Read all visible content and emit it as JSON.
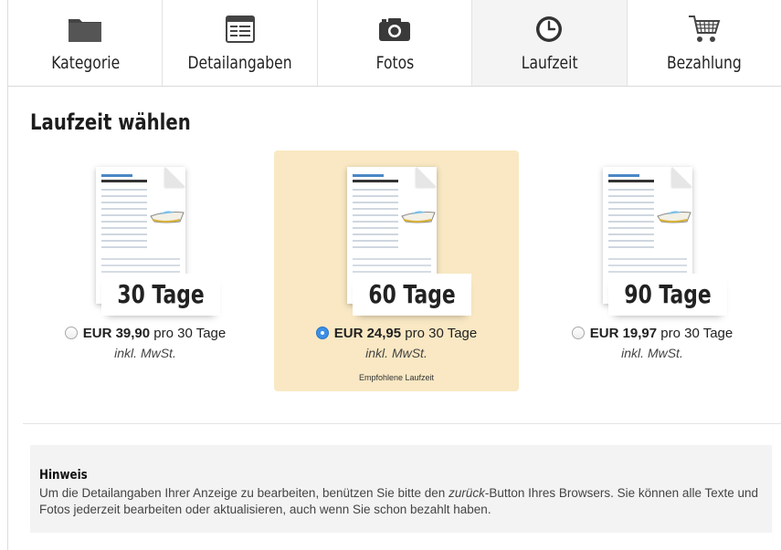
{
  "steps": [
    {
      "label": "Kategorie",
      "icon": "folder-icon"
    },
    {
      "label": "Detailangaben",
      "icon": "form-icon"
    },
    {
      "label": "Fotos",
      "icon": "camera-icon"
    },
    {
      "label": "Laufzeit",
      "icon": "clock-icon",
      "active": true
    },
    {
      "label": "Bezahlung",
      "icon": "cart-icon"
    }
  ],
  "section_title": "Laufzeit wählen",
  "options": [
    {
      "days_label": "30 Tage",
      "price": "EUR 39,90",
      "per": "pro 30 Tage",
      "vat": "inkl. MwSt.",
      "selected": false
    },
    {
      "days_label": "60 Tage",
      "price": "EUR 24,95",
      "per": "pro 30 Tage",
      "vat": "inkl. MwSt.",
      "selected": true,
      "note": "Empfohlene Laufzeit"
    },
    {
      "days_label": "90 Tage",
      "price": "EUR 19,97",
      "per": "pro 30 Tage",
      "vat": "inkl. MwSt.",
      "selected": false
    }
  ],
  "hint": {
    "title": "Hinweis",
    "text_before": "Um die Detailangaben Ihrer Anzeige zu bearbeiten, benützen Sie bitte den ",
    "text_emph": "zurück",
    "text_after": "-Button Ihres Browsers. Sie können alle Texte und Fotos jederzeit bearbeiten oder aktualisieren, auch wenn Sie schon bezahlt haben."
  },
  "colors": {
    "selected_bg": "#f9e8c3",
    "radio_checked": "#3b8fe6",
    "doc_accent": "#4a87c5"
  }
}
